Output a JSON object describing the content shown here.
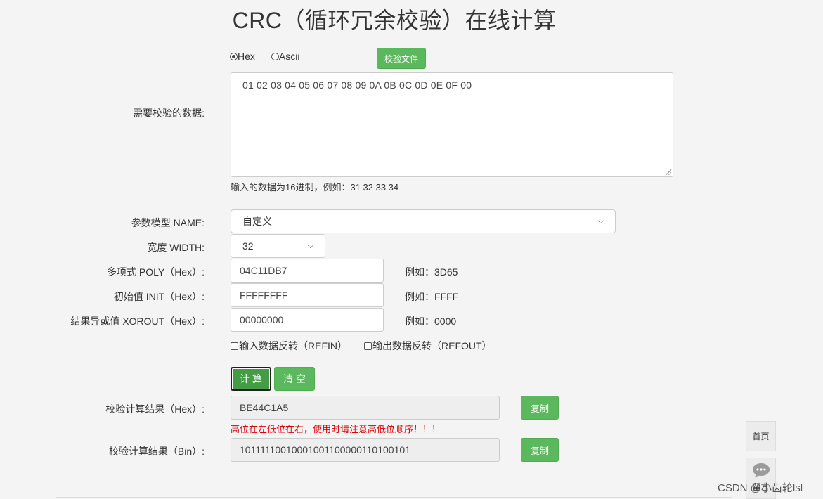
{
  "page": {
    "title": "CRC（循环冗余校验）在线计算"
  },
  "format": {
    "hex_label": "Hex",
    "ascii_label": "Ascii",
    "selected": "Hex",
    "file_button": "校验文件"
  },
  "data_input": {
    "label": "需要校验的数据:",
    "value": "01 02 03 04 05 06 07 08 09 0A 0B 0C 0D 0E 0F 00",
    "hint": "输入的数据为16进制，例如：31 32 33 34"
  },
  "params": {
    "model_label": "参数模型 NAME:",
    "model_value": "自定义",
    "width_label": "宽度 WIDTH:",
    "width_value": "32",
    "poly_label": "多项式 POLY（Hex）:",
    "poly_value": "04C11DB7",
    "poly_example": "例如：3D65",
    "init_label": "初始值 INIT（Hex）:",
    "init_value": "FFFFFFFF",
    "init_example": "例如：FFFF",
    "xorout_label": "结果异或值 XOROUT（Hex）:",
    "xorout_value": "00000000",
    "xorout_example": "例如：0000",
    "refin_label": "输入数据反转（REFIN）",
    "refout_label": "输出数据反转（REFOUT）"
  },
  "actions": {
    "calc": "计 算",
    "clear": "清 空"
  },
  "results": {
    "hex_label": "校验计算结果（Hex）:",
    "hex_value": "BE44C1A5",
    "copy_label": "复制",
    "warning": "高位在左低位在右，使用时请注意高低位顺序！！！",
    "bin_label": "校验计算结果（Bin）:",
    "bin_value": "10111110010001001100000110100101"
  },
  "sidebar": {
    "home": "首页",
    "comment": "留言"
  },
  "watermark": "CSDN @小齿轮lsl"
}
